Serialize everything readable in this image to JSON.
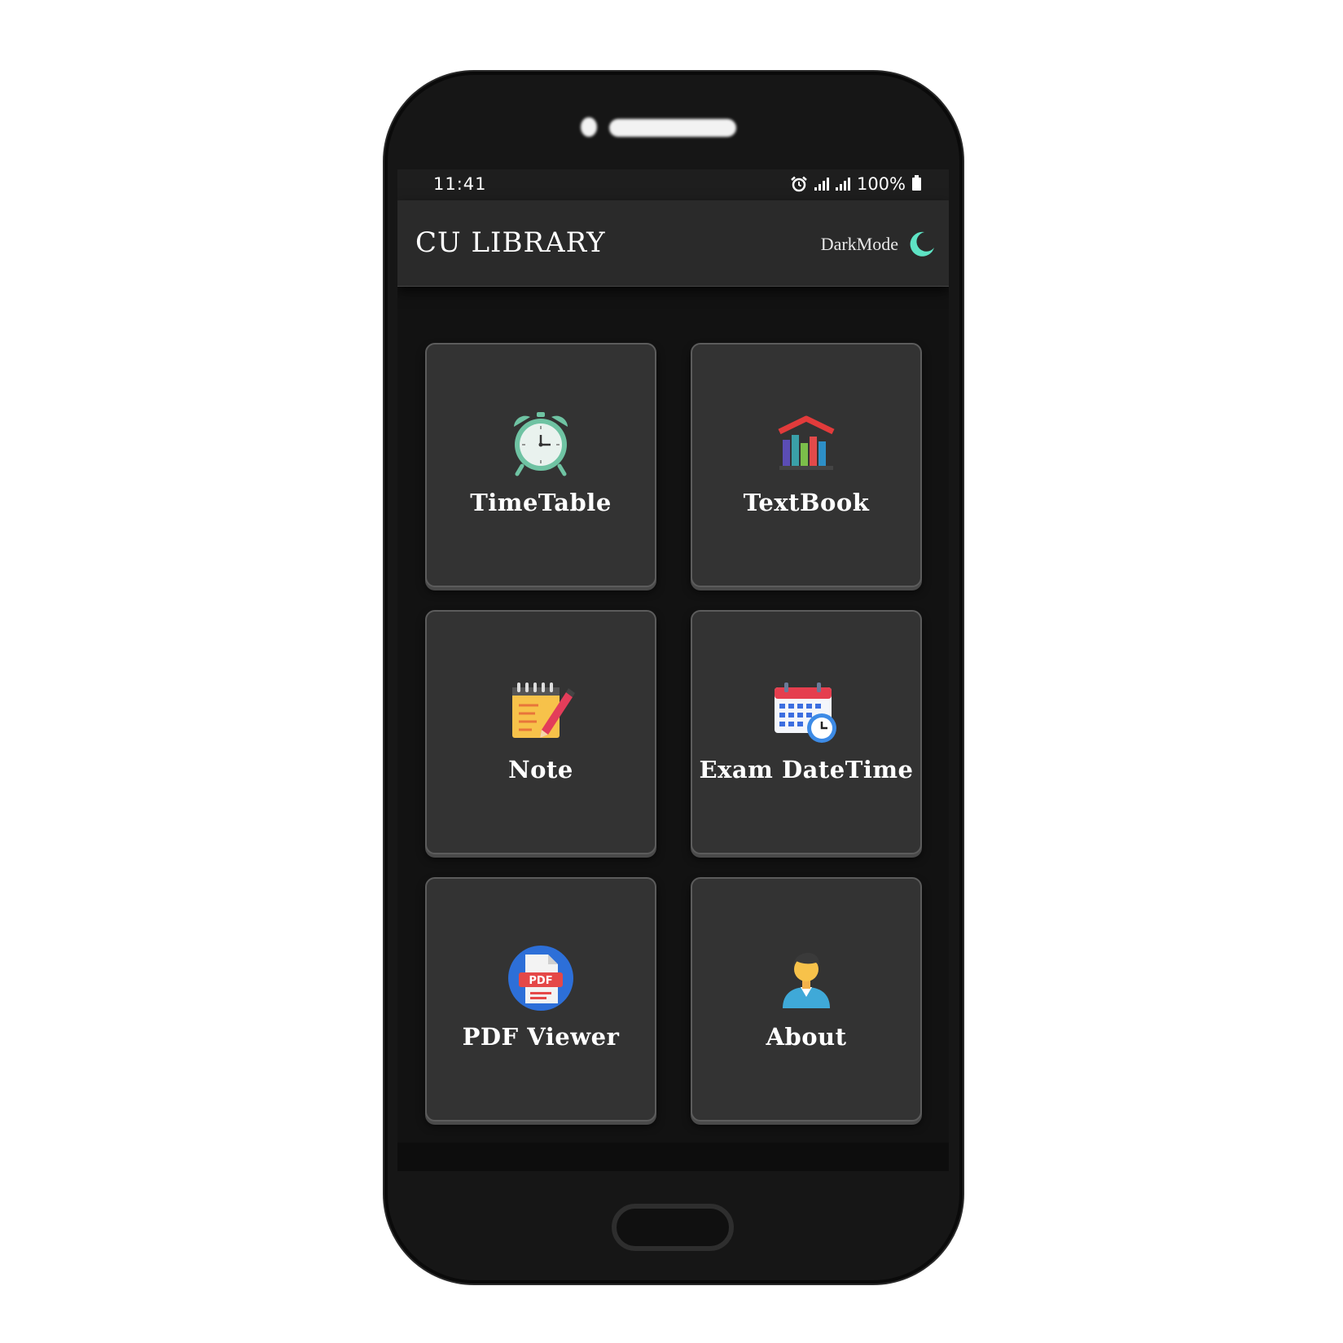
{
  "statusbar": {
    "time": "11:41",
    "battery_text": "100%"
  },
  "appbar": {
    "title": "CU LIBRARY",
    "darkmode_label": "DarkMode"
  },
  "menu": {
    "items": [
      {
        "label": "TimeTable",
        "icon": "alarm-clock-icon"
      },
      {
        "label": "TextBook",
        "icon": "books-icon"
      },
      {
        "label": "Note",
        "icon": "notepad-pen-icon"
      },
      {
        "label": "Exam DateTime",
        "icon": "calendar-clock-icon"
      },
      {
        "label": "PDF Viewer",
        "icon": "pdf-file-icon"
      },
      {
        "label": "About",
        "icon": "person-icon"
      }
    ]
  },
  "pdf_icon_text": "PDF",
  "colors": {
    "screen_bg": "#121212",
    "card_bg": "#333333",
    "appbar_bg": "#2a2a2a",
    "accent_moon": "#5ee3c4"
  }
}
